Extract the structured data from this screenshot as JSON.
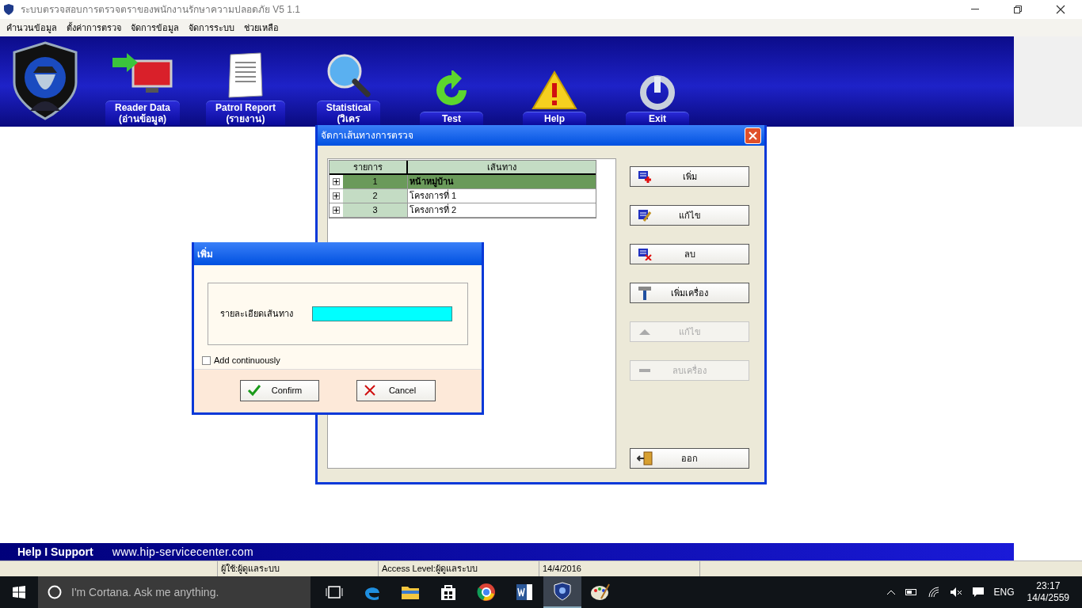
{
  "window": {
    "title": "ระบบตรวจสอบการตรวจตราของพนักงานรักษาความปลอดภัย V5 1.1"
  },
  "menu": [
    "คำนวนข้อมูล",
    "ตั้งค่าการตรวจ",
    "จัดการข้อมูล",
    "จัดการระบบ",
    "ช่วยเหลือ"
  ],
  "toolbar": [
    {
      "kind": "reader",
      "label": "Reader Data",
      "sublabel": "(อ่านข้อมูล)"
    },
    {
      "kind": "report",
      "label": "Patrol Report",
      "sublabel": "(รายงาน)"
    },
    {
      "kind": "statistical",
      "label": "Statistical",
      "sublabel": "(วิเคร"
    },
    {
      "kind": "test",
      "label": "Test"
    },
    {
      "kind": "help",
      "label": "Help"
    },
    {
      "kind": "exit",
      "label": "Exit"
    }
  ],
  "route_dialog": {
    "title": "จัดกาเส้นทางการตรวจ",
    "columns": [
      "รายการ",
      "เส้นทาง"
    ],
    "rows": [
      {
        "number": "1",
        "route": "หน้าหมู่บ้าน",
        "selected": true
      },
      {
        "number": "2",
        "route": "โครงการที่ 1",
        "selected": false
      },
      {
        "number": "3",
        "route": "โครงการที่ 2",
        "selected": false
      }
    ],
    "buttons": [
      {
        "kind": "add",
        "label": "เพิ่ม",
        "disabled": false
      },
      {
        "kind": "edit",
        "label": "แก้ไข",
        "disabled": false
      },
      {
        "kind": "delete",
        "label": "ลบ",
        "disabled": false
      },
      {
        "kind": "hammer",
        "label": "เพิ่มเครื่อง",
        "disabled": false
      },
      {
        "kind": "up",
        "label": "แก้ไข",
        "disabled": true
      },
      {
        "kind": "minus",
        "label": "ลบเครื่อง",
        "disabled": true
      },
      {
        "kind": "exit",
        "label": "ออก",
        "disabled": false
      }
    ]
  },
  "add_dialog": {
    "title": "เพิ่ม",
    "field_label": "รายละเอียดเส้นทาง",
    "add_continuously": {
      "label": "Add continuously",
      "checked": false
    },
    "buttons": [
      {
        "kind": "confirm",
        "label": "Confirm"
      },
      {
        "kind": "cancel",
        "label": "Cancel"
      }
    ]
  },
  "footer": {
    "help": "Help I Support",
    "url": "www.hip-servicecenter.com"
  },
  "status_bar": [
    "ผู้ใช้:ผู้ดูแลระบบ",
    "Access Level:ผู้ดูแลระบบ",
    "14/4/2016"
  ],
  "taskbar": {
    "search_placeholder": "I'm Cortana. Ask me anything.",
    "apps": [
      {
        "kind": "taskview",
        "selected": false
      },
      {
        "kind": "edge",
        "selected": false
      },
      {
        "kind": "explorer",
        "selected": false
      },
      {
        "kind": "store",
        "selected": false
      },
      {
        "kind": "chrome",
        "selected": false
      },
      {
        "kind": "word",
        "selected": false
      },
      {
        "kind": "shield",
        "selected": true
      },
      {
        "kind": "paint",
        "selected": false
      }
    ],
    "language": "ENG",
    "time": "23:17",
    "date": "14/4/2559"
  }
}
